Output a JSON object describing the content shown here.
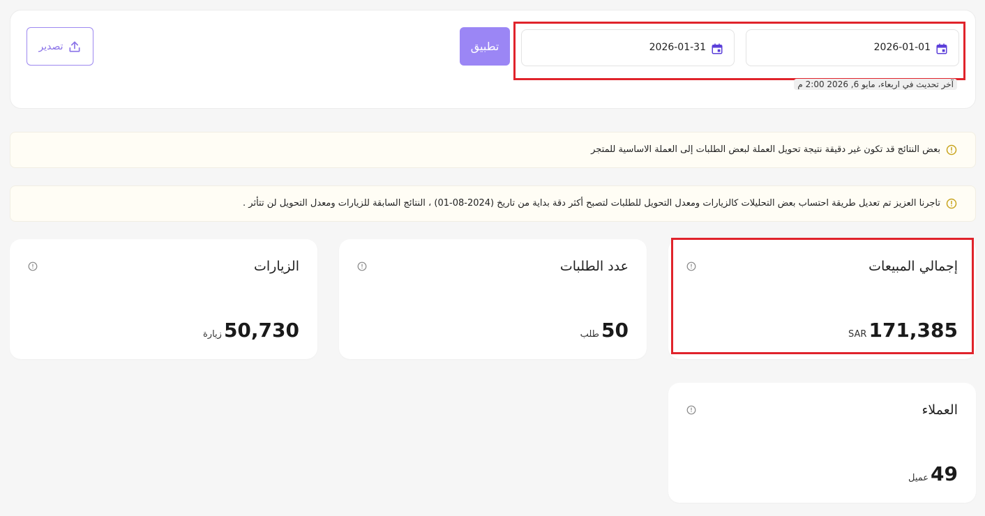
{
  "filter": {
    "date_from": "2026-01-01",
    "date_to": "2026-01-31",
    "apply_label": "تطبيق",
    "export_label": "تصدير",
    "last_updated": "آخر تحديث في اربعاء، مايو 6, 2026 2:00 م"
  },
  "notices": [
    {
      "text": "بعض النتائج قد تكون غير دقيقة نتيجة تحويل العملة لبعض الطلبات إلى العملة الاساسية للمتجر"
    },
    {
      "text": "تاجرنا العزيز تم تعديل طريقة احتساب بعض التحليلات كالزيارات ومعدل التحويل للطلبات لتصبح أكثر دقة بداية من تاريخ (2024-08-01) ، النتائج السابقة للزيارات ومعدل التحويل لن تتأثر ."
    }
  ],
  "stats": {
    "sales": {
      "title": "إجمالي المبيعات",
      "value": "171,385",
      "unit": "SAR"
    },
    "orders": {
      "title": "عدد الطلبات",
      "value": "50",
      "unit": "طلب"
    },
    "visits": {
      "title": "الزيارات",
      "value": "50,730",
      "unit": "زيارة"
    },
    "customers": {
      "title": "العملاء",
      "value": "49",
      "unit": "عميل"
    }
  },
  "colors": {
    "accent": "#9b86f5",
    "highlight": "#e0232b",
    "warning": "#c9a520"
  }
}
